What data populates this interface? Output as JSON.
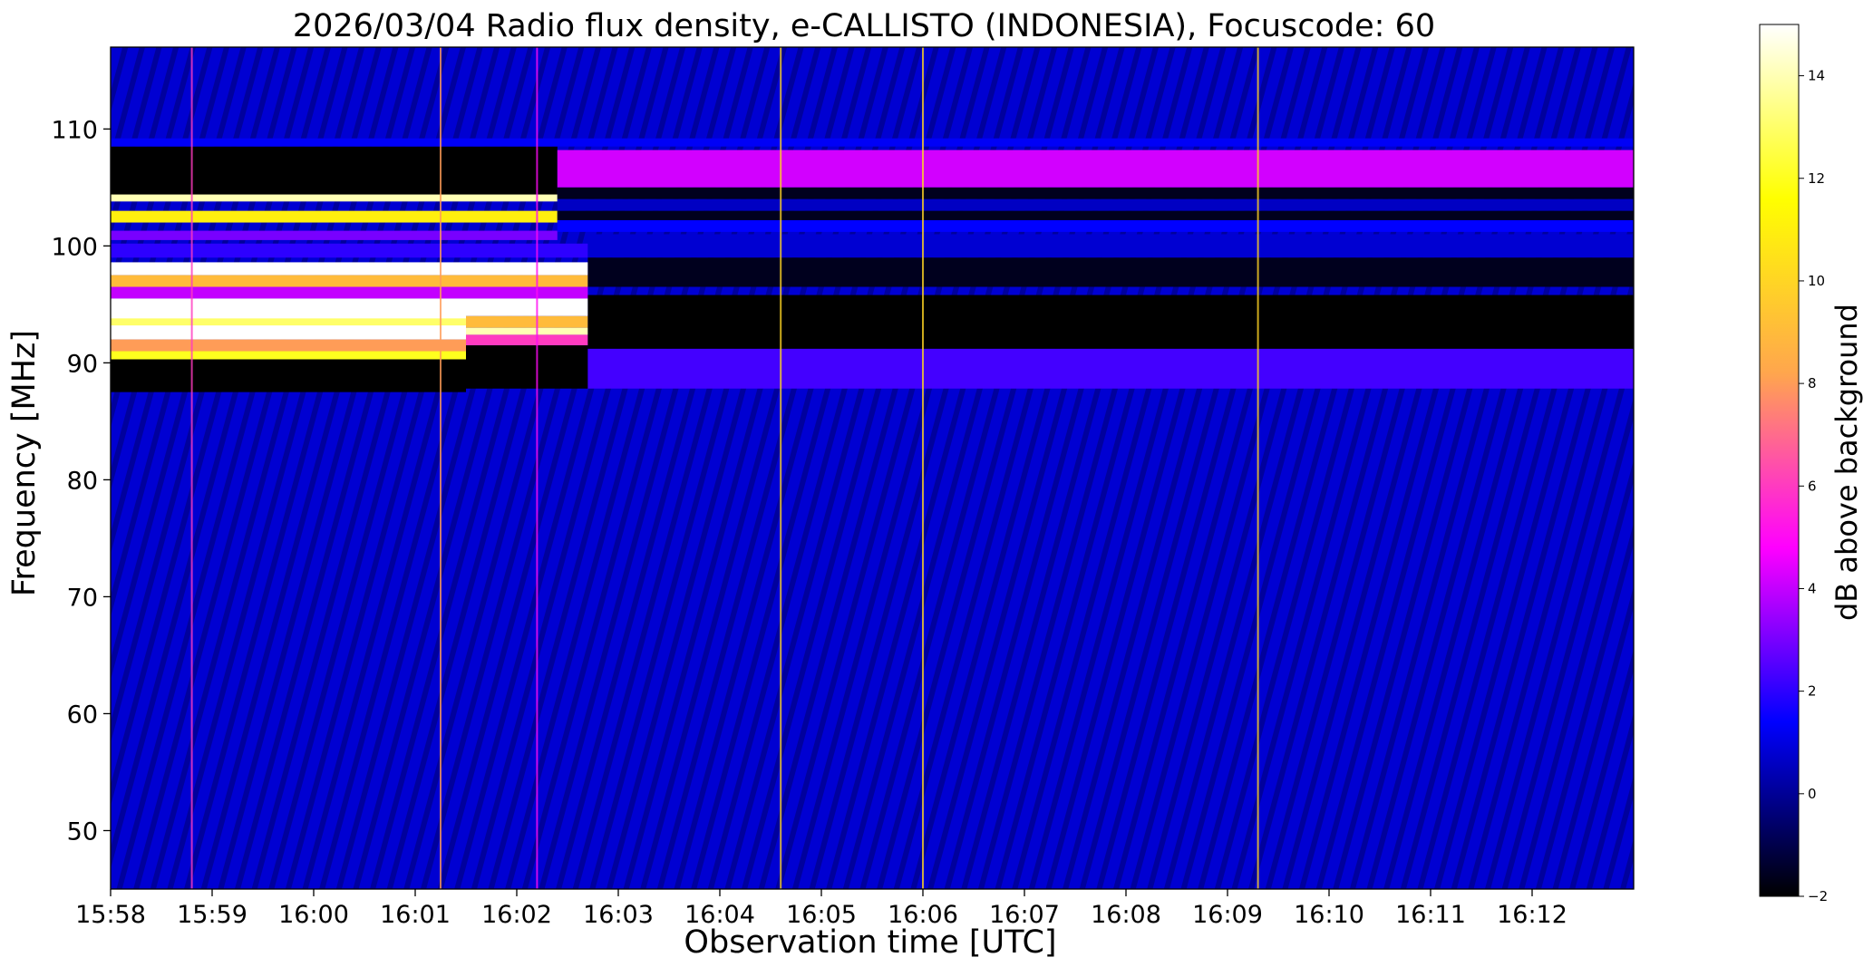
{
  "chart_data": {
    "type": "heatmap",
    "title": "2026/03/04  Radio flux density, e-CALLISTO (INDONESIA), Focuscode: 60",
    "xlabel": "Observation time [UTC]",
    "ylabel": "Frequency [MHz]",
    "colorbar_label": "dB above background",
    "x_ticks": [
      "15:58",
      "15:59",
      "16:00",
      "16:01",
      "16:02",
      "16:03",
      "16:04",
      "16:05",
      "16:06",
      "16:07",
      "16:08",
      "16:09",
      "16:10",
      "16:11",
      "16:12"
    ],
    "x_range_minutes": [
      0,
      15
    ],
    "y_ticks": [
      50,
      60,
      70,
      80,
      90,
      100,
      110
    ],
    "ylim": [
      45,
      117
    ],
    "colorbar_ticks": [
      -2,
      0,
      2,
      4,
      6,
      8,
      10,
      12,
      14
    ],
    "colorbar_range": [
      -2,
      15
    ],
    "colormap": [
      "#000000",
      "#0000ff",
      "#ff00ff",
      "#ffa64d",
      "#ffff00",
      "#ffffff"
    ],
    "background_db": 0.8,
    "bands": [
      {
        "t0": 0,
        "t1": 4.4,
        "f0": 104.2,
        "f1": 108.5,
        "db": -2
      },
      {
        "t0": 0,
        "t1": 4.4,
        "f0": 103.8,
        "f1": 104.4,
        "db": 14
      },
      {
        "t0": 0,
        "t1": 4.4,
        "f0": 102.0,
        "f1": 103.0,
        "db": 11
      },
      {
        "t0": 0,
        "t1": 4.4,
        "f0": 100.5,
        "f1": 101.3,
        "db": 3
      },
      {
        "t0": 0,
        "t1": 4.7,
        "f0": 99.0,
        "f1": 100.2,
        "db": 2
      },
      {
        "t0": 0,
        "t1": 4.7,
        "f0": 97.5,
        "f1": 98.6,
        "db": 15
      },
      {
        "t0": 0,
        "t1": 4.7,
        "f0": 96.5,
        "f1": 97.5,
        "db": 9
      },
      {
        "t0": 0,
        "t1": 4.7,
        "f0": 95.5,
        "f1": 96.5,
        "db": 4
      },
      {
        "t0": 0,
        "t1": 3.5,
        "f0": 92.0,
        "f1": 95.5,
        "db": 15
      },
      {
        "t0": 0,
        "t1": 3.5,
        "f0": 93.2,
        "f1": 93.8,
        "db": 13
      },
      {
        "t0": 0,
        "t1": 3.5,
        "f0": 91.0,
        "f1": 92.0,
        "db": 8
      },
      {
        "t0": 0,
        "t1": 3.5,
        "f0": 90.3,
        "f1": 91.0,
        "db": 12
      },
      {
        "t0": 0,
        "t1": 3.5,
        "f0": 87.5,
        "f1": 90.3,
        "db": -2
      },
      {
        "t0": 3.5,
        "t1": 4.7,
        "f0": 94.0,
        "f1": 95.5,
        "db": 15
      },
      {
        "t0": 3.5,
        "t1": 4.7,
        "f0": 93.0,
        "f1": 94.0,
        "db": 9
      },
      {
        "t0": 3.5,
        "t1": 4.7,
        "f0": 92.4,
        "f1": 93.0,
        "db": 14
      },
      {
        "t0": 3.5,
        "t1": 4.7,
        "f0": 91.5,
        "f1": 92.4,
        "db": 6
      },
      {
        "t0": 3.5,
        "t1": 4.7,
        "f0": 87.8,
        "f1": 91.5,
        "db": -2
      },
      {
        "t0": 4.4,
        "t1": 15,
        "f0": 105.0,
        "f1": 108.2,
        "db": 4.2
      },
      {
        "t0": 4.4,
        "t1": 15,
        "f0": 104.0,
        "f1": 105.0,
        "db": -1.6
      },
      {
        "t0": 4.4,
        "t1": 15,
        "f0": 103.0,
        "f1": 104.0,
        "db": 0.6
      },
      {
        "t0": 4.4,
        "t1": 15,
        "f0": 102.2,
        "f1": 103.0,
        "db": -1.6
      },
      {
        "t0": 4.4,
        "t1": 15,
        "f0": 101.2,
        "f1": 102.2,
        "db": 1.4
      },
      {
        "t0": 4.7,
        "t1": 15,
        "f0": 99.0,
        "f1": 101.0,
        "db": 0.8
      },
      {
        "t0": 4.7,
        "t1": 15,
        "f0": 96.5,
        "f1": 99.0,
        "db": -1.6
      },
      {
        "t0": 4.7,
        "t1": 15,
        "f0": 91.2,
        "f1": 95.8,
        "db": -2
      },
      {
        "t0": 4.7,
        "t1": 15,
        "f0": 87.8,
        "f1": 91.2,
        "db": 2.3
      },
      {
        "t0": 0,
        "t1": 15,
        "f0": 108.5,
        "f1": 109.2,
        "db": 1.3
      }
    ],
    "vertical_lines": [
      {
        "t": 0.8,
        "db": 6
      },
      {
        "t": 3.25,
        "db": 8
      },
      {
        "t": 4.2,
        "db": 5
      },
      {
        "t": 6.6,
        "db": 10
      },
      {
        "t": 8.0,
        "db": 10
      },
      {
        "t": 11.3,
        "db": 10
      }
    ]
  }
}
